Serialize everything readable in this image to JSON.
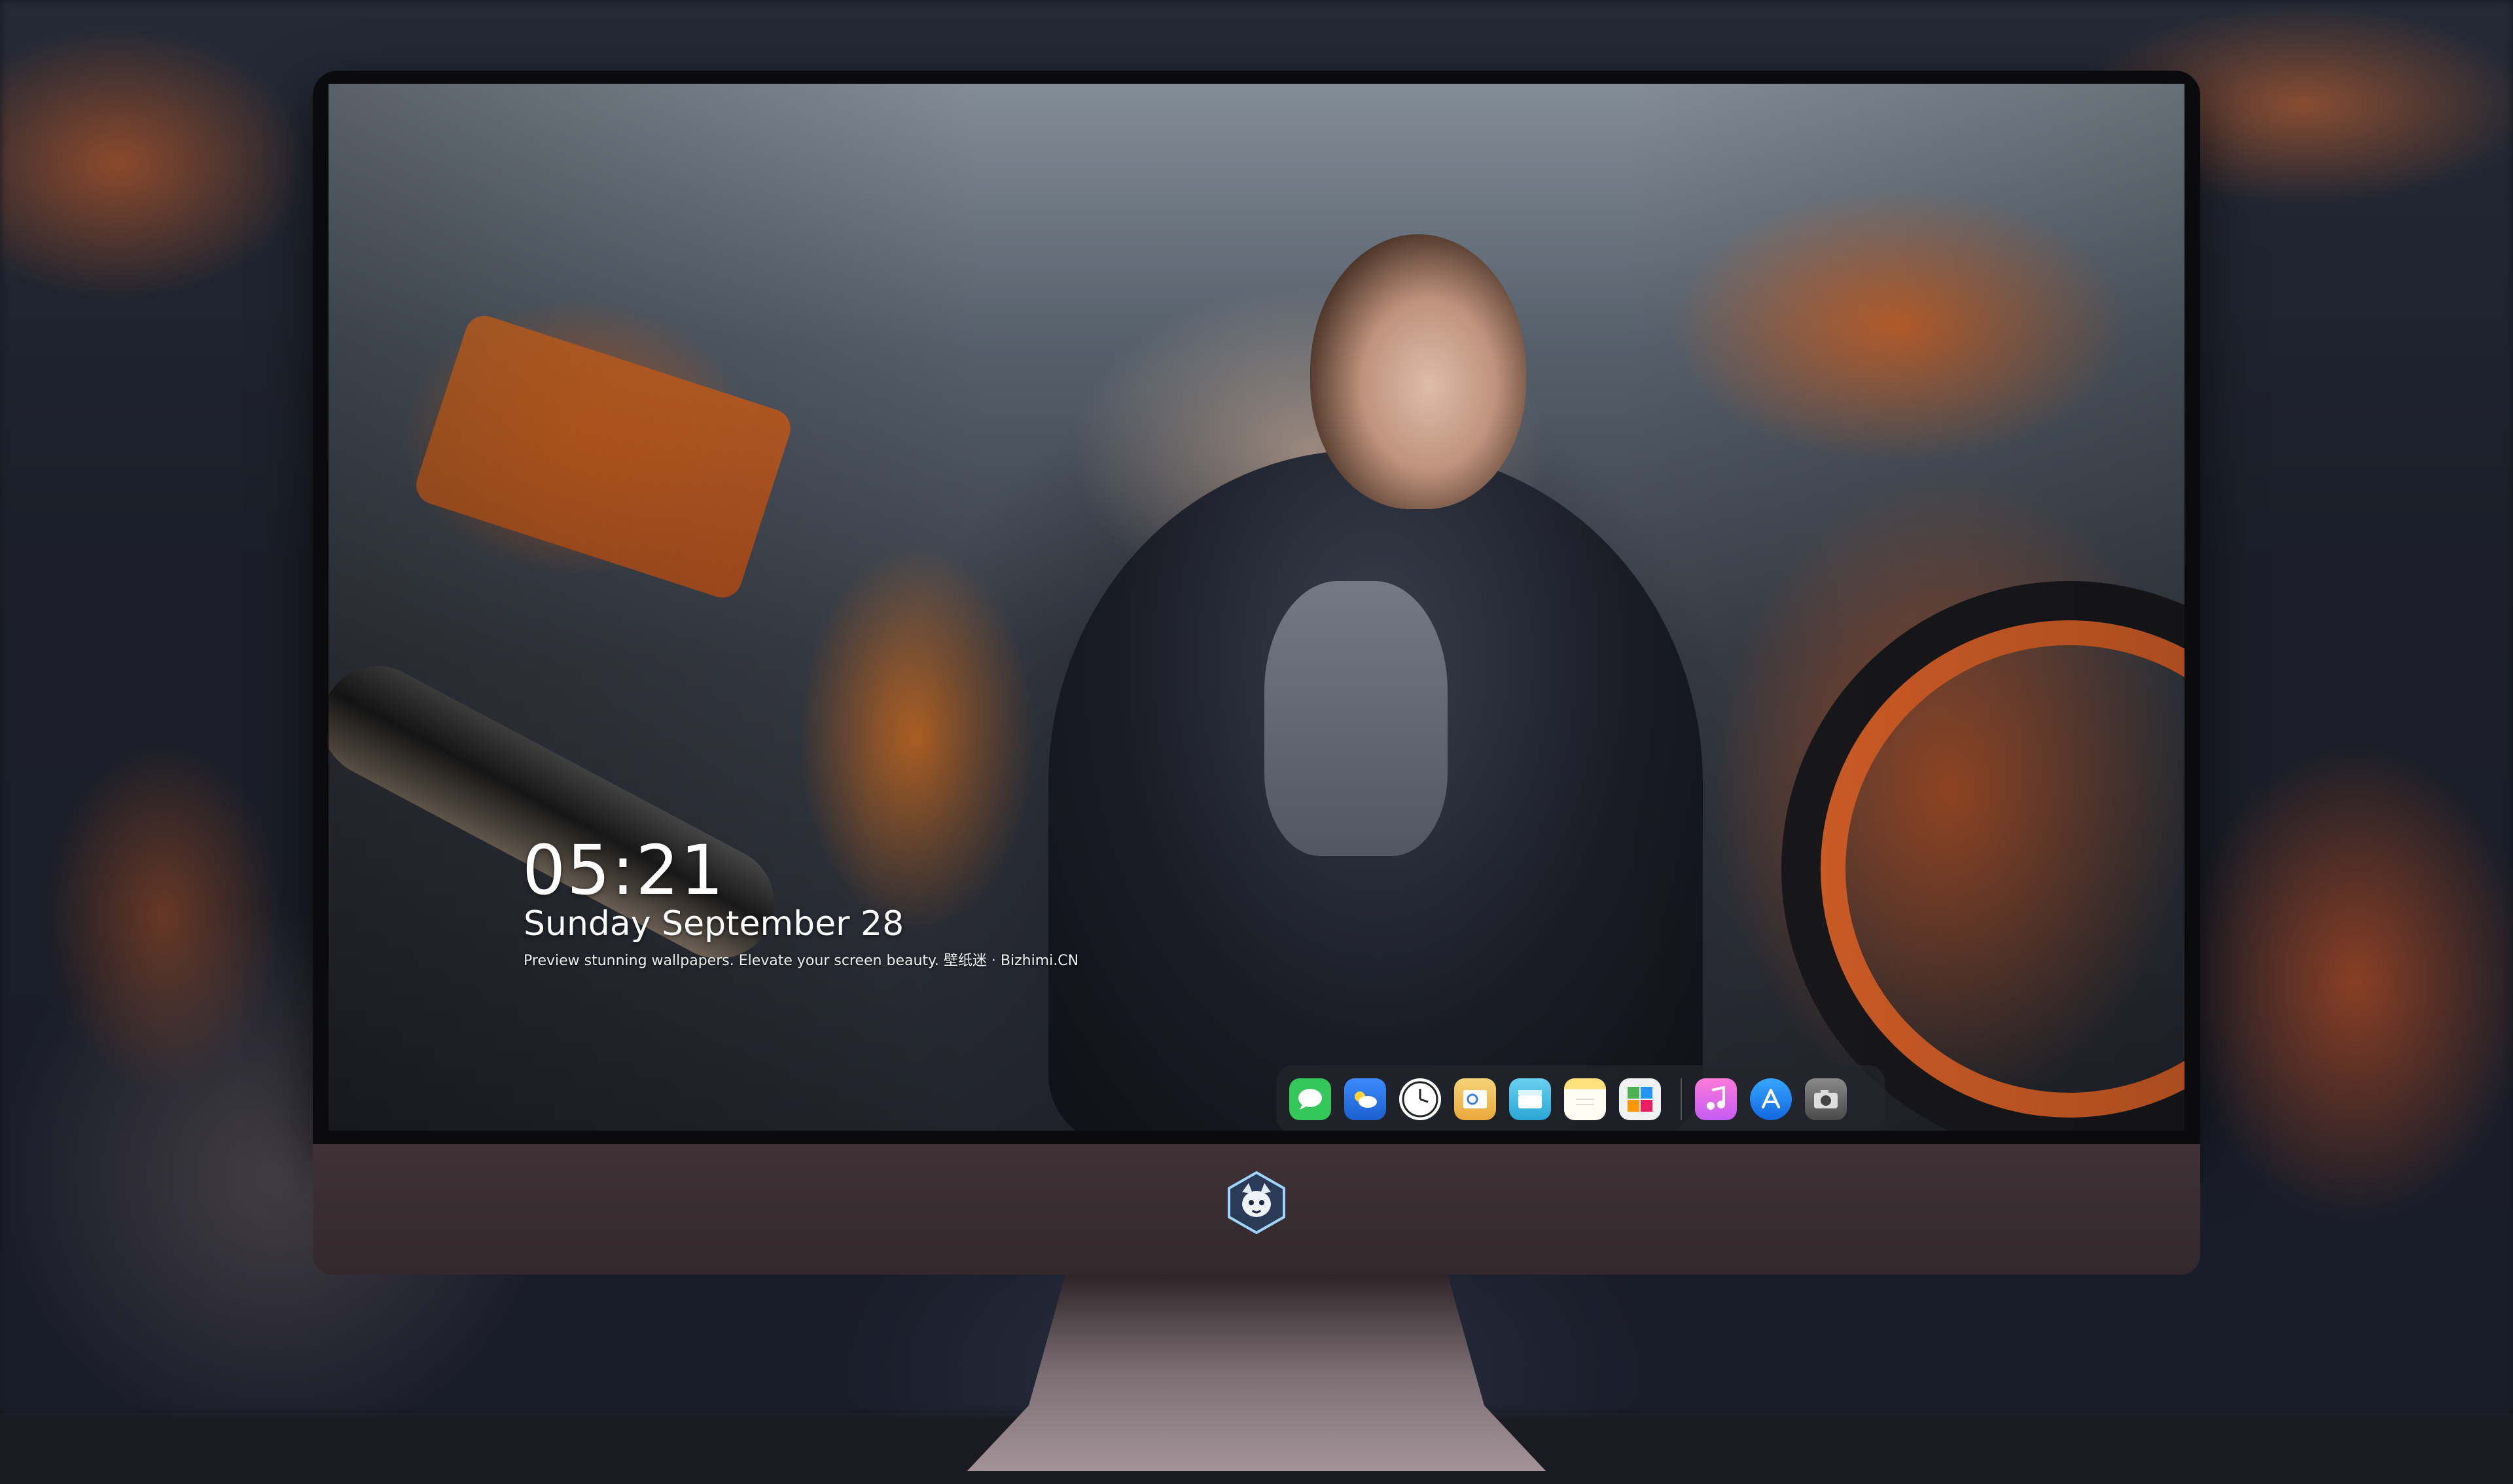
{
  "wallpaper": {
    "clock_time": "05:21",
    "clock_date": "Sunday September 28",
    "caption": "Preview stunning wallpapers. Elevate your screen beauty. 壁纸迷 · Bizhimi.CN"
  },
  "dock": {
    "apps": [
      {
        "name": "messages-icon",
        "glyph": "💬",
        "color": "#34c759"
      },
      {
        "name": "weather-icon",
        "glyph": "⛅",
        "color": "#3d8bfd"
      },
      {
        "name": "clock-icon",
        "glyph": "🕐",
        "color": "#ffffff"
      },
      {
        "name": "preview-icon",
        "glyph": "🖼",
        "color": "#f5c542"
      },
      {
        "name": "clips-icon",
        "glyph": "🎬",
        "color": "#45c2e8"
      },
      {
        "name": "notes-icon",
        "glyph": "📝",
        "color": "#ffd54a"
      },
      {
        "name": "photo-booth-icon",
        "glyph": "🏞",
        "color": "#e8e8e8"
      },
      {
        "name": "itunes-icon",
        "glyph": "♫",
        "color": "#fc5bc0"
      },
      {
        "name": "app-store-icon",
        "glyph": "A",
        "color": "#1e88ff"
      },
      {
        "name": "screenshot-icon",
        "glyph": "📷",
        "color": "#5a5a5a"
      }
    ]
  },
  "colors": {
    "accent_orange": "#e4662a",
    "chin": "#3e3236",
    "bezel": "#0b0b0d"
  },
  "monitor": {
    "logo_icon": "fox-mascot-icon"
  }
}
